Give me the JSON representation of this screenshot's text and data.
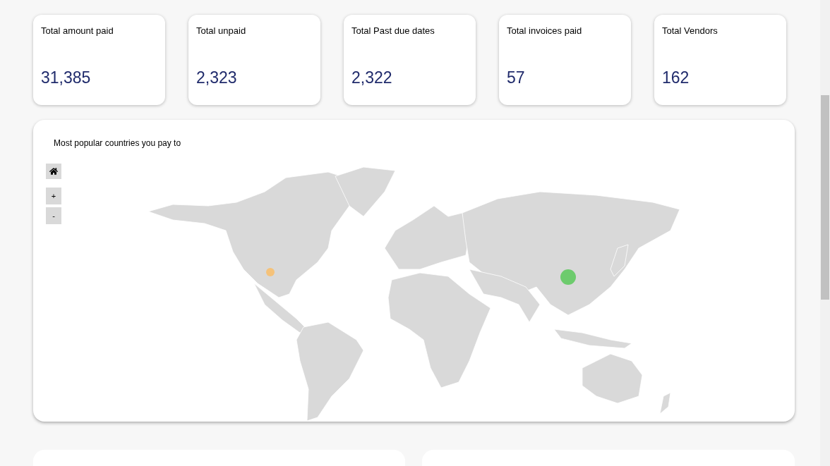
{
  "stats": [
    {
      "label": "Total amount paid",
      "value": "31,385"
    },
    {
      "label": "Total unpaid",
      "value": "2,323"
    },
    {
      "label": "Total Past due dates",
      "value": "2,322"
    },
    {
      "label": "Total invoices paid",
      "value": "57"
    },
    {
      "label": "Total Vendors",
      "value": "162"
    }
  ],
  "map": {
    "title": "Most popular countries you pay to",
    "zoom_controls": [
      "+",
      "-"
    ],
    "markers": [
      {
        "kind": "small",
        "color": "#f5c27a"
      },
      {
        "kind": "large",
        "color": "#6dcb6d"
      }
    ]
  }
}
